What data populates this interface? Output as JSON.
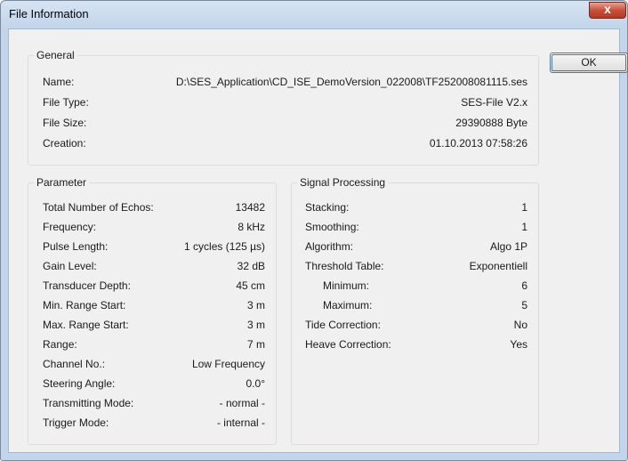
{
  "window": {
    "title": "File Information",
    "close_glyph": "x"
  },
  "ok_label": "OK",
  "general": {
    "title": "General",
    "rows": [
      {
        "label": "Name:",
        "value": "D:\\SES_Application\\CD_ISE_DemoVersion_022008\\TF252008081115.ses"
      },
      {
        "label": "File Type:",
        "value": "SES-File V2.x"
      },
      {
        "label": "File Size:",
        "value": "29390888 Byte"
      },
      {
        "label": "Creation:",
        "value": "01.10.2013 07:58:26"
      }
    ]
  },
  "parameter": {
    "title": "Parameter",
    "rows": [
      {
        "label": "Total Number of Echos:",
        "value": "13482"
      },
      {
        "label": "Frequency:",
        "value": "8 kHz"
      },
      {
        "label": "Pulse Length:",
        "value": "1 cycles (125 µs)"
      },
      {
        "label": "Gain Level:",
        "value": "32 dB"
      },
      {
        "label": "Transducer Depth:",
        "value": "45 cm"
      },
      {
        "label": "Min. Range Start:",
        "value": "3 m"
      },
      {
        "label": "Max. Range Start:",
        "value": "3 m"
      },
      {
        "label": "Range:",
        "value": "7 m"
      },
      {
        "label": "Channel No.:",
        "value": "Low Frequency"
      },
      {
        "label": "Steering Angle:",
        "value": "0.0°"
      },
      {
        "label": "Transmitting Mode:",
        "value": "- normal -"
      },
      {
        "label": "Trigger Mode:",
        "value": "- internal -"
      }
    ]
  },
  "signal": {
    "title": "Signal Processing",
    "rows": [
      {
        "label": "Stacking:",
        "value": "1"
      },
      {
        "label": "Smoothing:",
        "value": "1"
      },
      {
        "label": "Algorithm:",
        "value": "Algo 1P"
      },
      {
        "label": "Threshold Table:",
        "value": "Exponentiell"
      },
      {
        "label": "Minimum:",
        "value": "6"
      },
      {
        "label": "Maximum:",
        "value": "5"
      },
      {
        "label": "Tide Correction:",
        "value": "No"
      },
      {
        "label": "Heave Correction:",
        "value": "Yes"
      }
    ]
  }
}
